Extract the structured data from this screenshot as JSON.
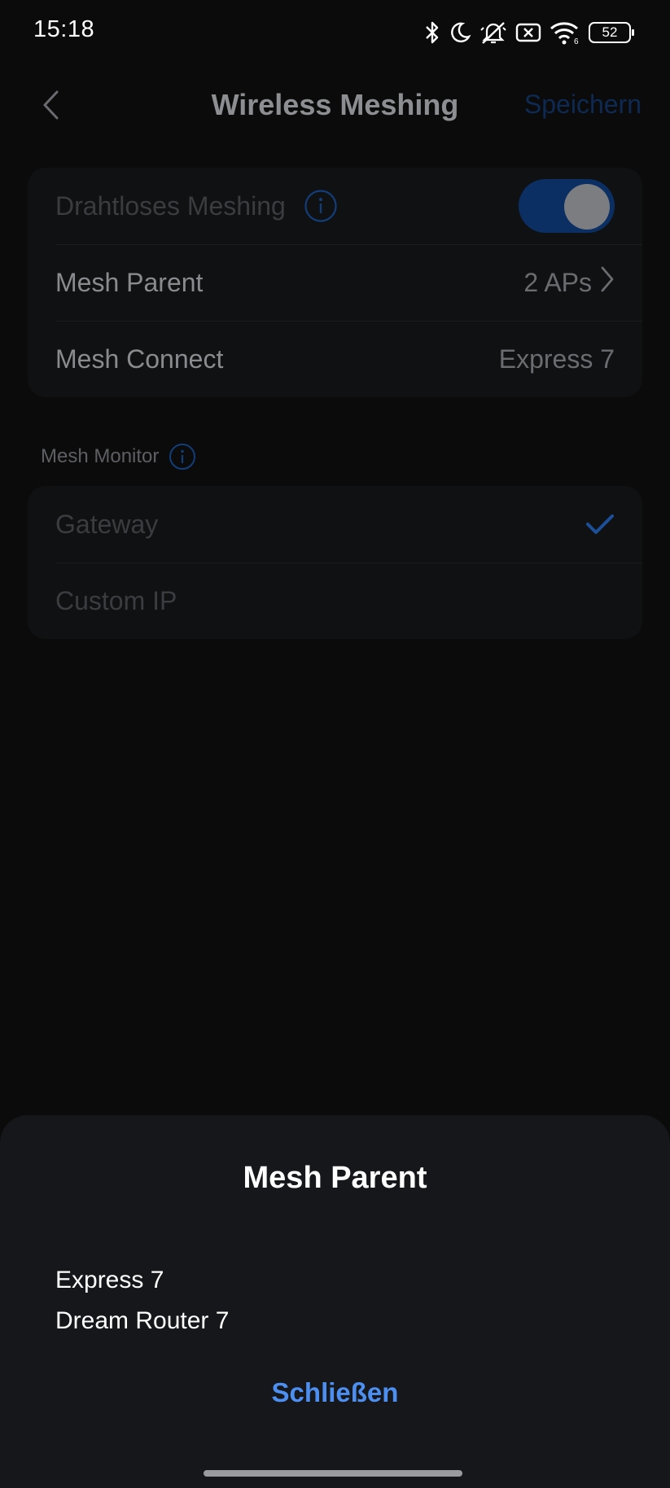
{
  "status_bar": {
    "time": "15:18",
    "icons": [
      "bluetooth-icon",
      "moon-icon",
      "bell-off-icon",
      "sim-off-icon",
      "wifi-6-icon",
      "battery-icon"
    ],
    "battery_level": "52",
    "wifi_badge": "6"
  },
  "header": {
    "title": "Wireless Meshing",
    "save_label": "Speichern",
    "back_icon": "chevron-left-icon"
  },
  "settings_card": {
    "rows": [
      {
        "label": "Drahtloses Meshing",
        "toggle_on": true,
        "info_icon": "info-icon"
      },
      {
        "label": "Mesh Parent",
        "value": "2 APs",
        "chevron": "chevron-right-icon"
      },
      {
        "label": "Mesh Connect",
        "value": "Express 7"
      }
    ]
  },
  "mesh_monitor": {
    "section_label": "Mesh Monitor",
    "options": [
      {
        "label": "Gateway",
        "selected": true
      },
      {
        "label": "Custom IP",
        "selected": false
      }
    ]
  },
  "sheet": {
    "title": "Mesh Parent",
    "items": [
      "Express 7",
      "Dream Router 7"
    ],
    "close_label": "Schließen"
  },
  "colors": {
    "accent": "#4d8ff0",
    "background": "#0b0b0c",
    "sheet_bg": "#16171a",
    "dim_accent": "#0e2a52"
  }
}
